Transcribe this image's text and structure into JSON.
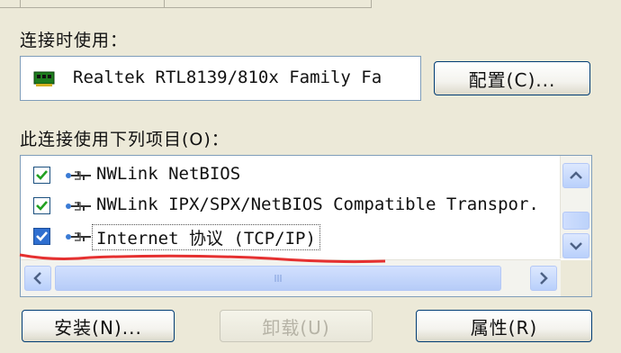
{
  "connect_using_label": "连接时使用：",
  "adapter": {
    "name": "Realtek RTL8139/810x Family Fa",
    "configure_button": "配置(C)..."
  },
  "components_label": "此连接使用下列项目(O)：",
  "components": [
    {
      "label": "NWLink NetBIOS",
      "checked": true
    },
    {
      "label": "NWLink IPX/SPX/NetBIOS Compatible Transpor.",
      "checked": true
    },
    {
      "label": "Internet 协议 (TCP/IP)",
      "checked": true,
      "selected": true
    }
  ],
  "buttons": {
    "install": "安装(N)...",
    "uninstall": "卸载(U)",
    "properties": "属性(R)"
  },
  "colors": {
    "dialog_bg": "#ece9d8",
    "check": "#21a121",
    "scroll_accent": "#4d6185",
    "annotation": "#e53030"
  },
  "icons": [
    "network-adapter-icon",
    "network-protocol-icon",
    "check-icon",
    "scroll-up-icon",
    "scroll-down-icon",
    "scroll-left-icon",
    "scroll-right-icon"
  ]
}
